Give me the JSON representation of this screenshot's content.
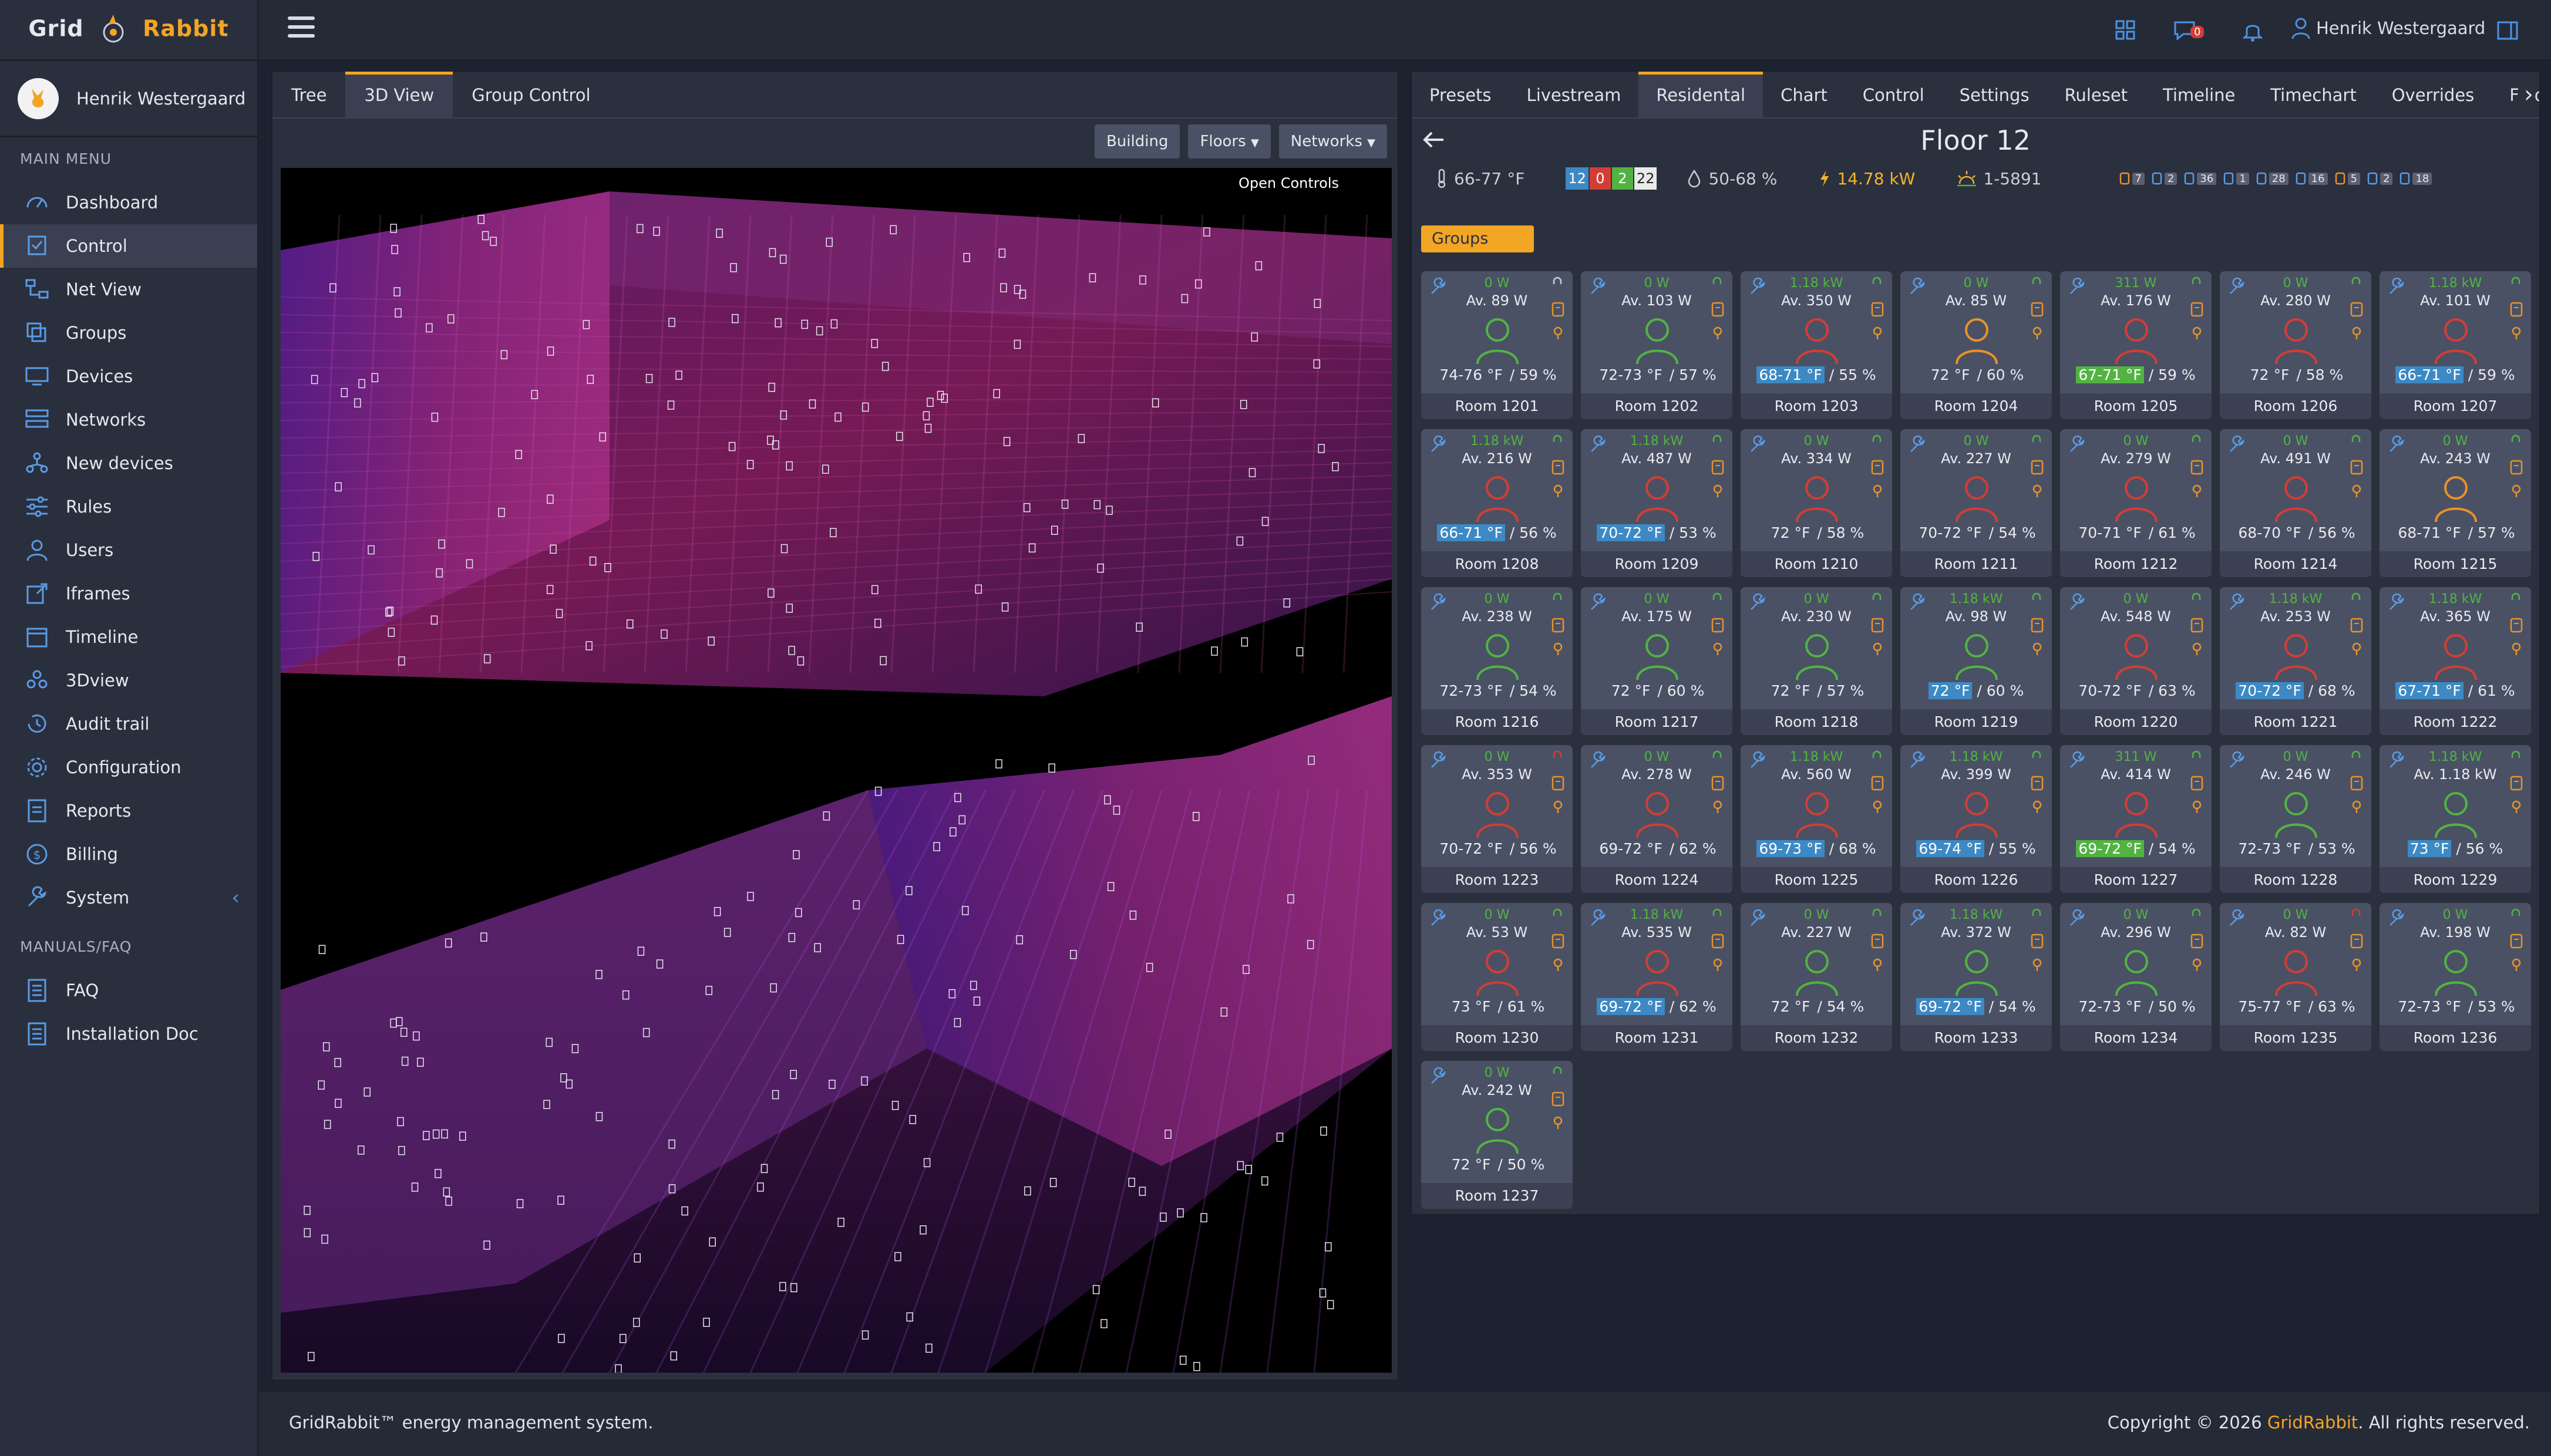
{
  "brand": {
    "part1": "Grid",
    "part2": "Rabbit"
  },
  "user": {
    "name": "Henrik Westergaard"
  },
  "sidebar": {
    "main_header": "MAIN MENU",
    "items": [
      {
        "label": "Dashboard",
        "icon": "dashboard-icon"
      },
      {
        "label": "Control",
        "icon": "control-icon",
        "active": true
      },
      {
        "label": "Net View",
        "icon": "net-view-icon"
      },
      {
        "label": "Groups",
        "icon": "groups-icon"
      },
      {
        "label": "Devices",
        "icon": "devices-icon"
      },
      {
        "label": "Networks",
        "icon": "networks-icon"
      },
      {
        "label": "New devices",
        "icon": "new-devices-icon"
      },
      {
        "label": "Rules",
        "icon": "rules-icon"
      },
      {
        "label": "Users",
        "icon": "users-icon"
      },
      {
        "label": "Iframes",
        "icon": "iframes-icon"
      },
      {
        "label": "Timeline",
        "icon": "timeline-icon"
      },
      {
        "label": "3Dview",
        "icon": "3dview-icon"
      },
      {
        "label": "Audit trail",
        "icon": "audit-trail-icon"
      },
      {
        "label": "Configuration",
        "icon": "configuration-icon"
      },
      {
        "label": "Reports",
        "icon": "reports-icon"
      },
      {
        "label": "Billing",
        "icon": "billing-icon"
      },
      {
        "label": "System",
        "icon": "system-icon"
      }
    ],
    "manuals_header": "MANUALS/FAQ",
    "manuals": [
      {
        "label": "FAQ",
        "icon": "faq-icon"
      },
      {
        "label": "Installation Doc",
        "icon": "installation-doc-icon"
      }
    ]
  },
  "topbar": {
    "message_count": "0"
  },
  "left_panel": {
    "tabs": [
      "Tree",
      "3D View",
      "Group Control"
    ],
    "active_tab": 1,
    "buttons": {
      "building": "Building",
      "floors": "Floors",
      "networks": "Networks"
    },
    "open_controls": "Open Controls"
  },
  "right_panel": {
    "tabs": [
      "Presets",
      "Livestream",
      "Residental",
      "Chart",
      "Control",
      "Settings",
      "Ruleset",
      "Timeline",
      "Timechart",
      "Overrides",
      "Floorp"
    ],
    "active_tab": 2,
    "floor_title": "Floor 12",
    "stats": {
      "temp": "66-77 °F",
      "counts": {
        "blue": "12",
        "red": "0",
        "green": "2",
        "white": "22"
      },
      "humidity": "50-68 %",
      "power": "14.78 kW",
      "light": "1-5891"
    },
    "device_badges": [
      "7",
      "2",
      "36",
      "1",
      "28",
      "16",
      "5",
      "2",
      "18"
    ],
    "groups_label": "Groups",
    "rooms": [
      {
        "name": "Room 1201",
        "cur": "0 W",
        "avg": "Av. 89 W",
        "temp": "74-76 °F",
        "hum": "59 %",
        "tc": "",
        "pc": "green",
        "cc": "white"
      },
      {
        "name": "Room 1202",
        "cur": "0 W",
        "avg": "Av. 103 W",
        "temp": "72-73 °F",
        "hum": "57 %",
        "tc": "",
        "pc": "green",
        "cc": "green"
      },
      {
        "name": "Room 1203",
        "cur": "1.18 kW",
        "avg": "Av. 350 W",
        "temp": "68-71 °F",
        "hum": "55 %",
        "tc": "blue",
        "pc": "red",
        "cc": "green"
      },
      {
        "name": "Room 1204",
        "cur": "0 W",
        "avg": "Av. 85 W",
        "temp": "72 °F",
        "hum": "60 %",
        "tc": "",
        "pc": "orange",
        "cc": "green"
      },
      {
        "name": "Room 1205",
        "cur": "311 W",
        "avg": "Av. 176 W",
        "temp": "67-71 °F",
        "hum": "59 %",
        "tc": "green",
        "pc": "red",
        "cc": "green"
      },
      {
        "name": "Room 1206",
        "cur": "0 W",
        "avg": "Av. 280 W",
        "temp": "72 °F",
        "hum": "58 %",
        "tc": "",
        "pc": "red",
        "cc": "green"
      },
      {
        "name": "Room 1207",
        "cur": "1.18 kW",
        "avg": "Av. 101 W",
        "temp": "66-71 °F",
        "hum": "59 %",
        "tc": "blue",
        "pc": "red",
        "cc": "green"
      },
      {
        "name": "Room 1208",
        "cur": "1.18 kW",
        "avg": "Av. 216 W",
        "temp": "66-71 °F",
        "hum": "56 %",
        "tc": "blue",
        "pc": "red",
        "cc": "green"
      },
      {
        "name": "Room 1209",
        "cur": "1.18 kW",
        "avg": "Av. 487 W",
        "temp": "70-72 °F",
        "hum": "53 %",
        "tc": "blue",
        "pc": "red",
        "cc": "green"
      },
      {
        "name": "Room 1210",
        "cur": "0 W",
        "avg": "Av. 334 W",
        "temp": "72 °F",
        "hum": "58 %",
        "tc": "",
        "pc": "red",
        "cc": "green"
      },
      {
        "name": "Room 1211",
        "cur": "0 W",
        "avg": "Av. 227 W",
        "temp": "70-72 °F",
        "hum": "54 %",
        "tc": "",
        "pc": "red",
        "cc": "green"
      },
      {
        "name": "Room 1212",
        "cur": "0 W",
        "avg": "Av. 279 W",
        "temp": "70-71 °F",
        "hum": "61 %",
        "tc": "",
        "pc": "red",
        "cc": "green"
      },
      {
        "name": "Room 1214",
        "cur": "0 W",
        "avg": "Av. 491 W",
        "temp": "68-70 °F",
        "hum": "56 %",
        "tc": "",
        "pc": "red",
        "cc": "green"
      },
      {
        "name": "Room 1215",
        "cur": "0 W",
        "avg": "Av. 243 W",
        "temp": "68-71 °F",
        "hum": "57 %",
        "tc": "",
        "pc": "orange",
        "cc": "green"
      },
      {
        "name": "Room 1216",
        "cur": "0 W",
        "avg": "Av. 238 W",
        "temp": "72-73 °F",
        "hum": "54 %",
        "tc": "",
        "pc": "green",
        "cc": "green"
      },
      {
        "name": "Room 1217",
        "cur": "0 W",
        "avg": "Av. 175 W",
        "temp": "72 °F",
        "hum": "60 %",
        "tc": "",
        "pc": "green",
        "cc": "green"
      },
      {
        "name": "Room 1218",
        "cur": "0 W",
        "avg": "Av. 230 W",
        "temp": "72 °F",
        "hum": "57 %",
        "tc": "",
        "pc": "green",
        "cc": "green"
      },
      {
        "name": "Room 1219",
        "cur": "1.18 kW",
        "avg": "Av. 98 W",
        "temp": "72 °F",
        "hum": "60 %",
        "tc": "blue",
        "pc": "green",
        "cc": "green"
      },
      {
        "name": "Room 1220",
        "cur": "0 W",
        "avg": "Av. 548 W",
        "temp": "70-72 °F",
        "hum": "63 %",
        "tc": "",
        "pc": "red",
        "cc": "green"
      },
      {
        "name": "Room 1221",
        "cur": "1.18 kW",
        "avg": "Av. 253 W",
        "temp": "70-72 °F",
        "hum": "68 %",
        "tc": "blue",
        "pc": "red",
        "cc": "green"
      },
      {
        "name": "Room 1222",
        "cur": "1.18 kW",
        "avg": "Av. 365 W",
        "temp": "67-71 °F",
        "hum": "61 %",
        "tc": "blue",
        "pc": "red",
        "cc": "green"
      },
      {
        "name": "Room 1223",
        "cur": "0 W",
        "avg": "Av. 353 W",
        "temp": "70-72 °F",
        "hum": "56 %",
        "tc": "",
        "pc": "red",
        "cc": "red"
      },
      {
        "name": "Room 1224",
        "cur": "0 W",
        "avg": "Av. 278 W",
        "temp": "69-72 °F",
        "hum": "62 %",
        "tc": "",
        "pc": "red",
        "cc": "green"
      },
      {
        "name": "Room 1225",
        "cur": "1.18 kW",
        "avg": "Av. 560 W",
        "temp": "69-73 °F",
        "hum": "68 %",
        "tc": "blue",
        "pc": "red",
        "cc": "green"
      },
      {
        "name": "Room 1226",
        "cur": "1.18 kW",
        "avg": "Av. 399 W",
        "temp": "69-74 °F",
        "hum": "55 %",
        "tc": "blue",
        "pc": "red",
        "cc": "green"
      },
      {
        "name": "Room 1227",
        "cur": "311 W",
        "avg": "Av. 414 W",
        "temp": "69-72 °F",
        "hum": "54 %",
        "tc": "green",
        "pc": "red",
        "cc": "green"
      },
      {
        "name": "Room 1228",
        "cur": "0 W",
        "avg": "Av. 246 W",
        "temp": "72-73 °F",
        "hum": "53 %",
        "tc": "",
        "pc": "green",
        "cc": "green"
      },
      {
        "name": "Room 1229",
        "cur": "1.18 kW",
        "avg": "Av. 1.18 kW",
        "temp": "73 °F",
        "hum": "56 %",
        "tc": "blue",
        "pc": "green",
        "cc": "green"
      },
      {
        "name": "Room 1230",
        "cur": "0 W",
        "avg": "Av. 53 W",
        "temp": "73 °F",
        "hum": "61 %",
        "tc": "",
        "pc": "red",
        "cc": "green"
      },
      {
        "name": "Room 1231",
        "cur": "1.18 kW",
        "avg": "Av. 535 W",
        "temp": "69-72 °F",
        "hum": "62 %",
        "tc": "blue",
        "pc": "red",
        "cc": "green"
      },
      {
        "name": "Room 1232",
        "cur": "0 W",
        "avg": "Av. 227 W",
        "temp": "72 °F",
        "hum": "54 %",
        "tc": "",
        "pc": "green",
        "cc": "green"
      },
      {
        "name": "Room 1233",
        "cur": "1.18 kW",
        "avg": "Av. 372 W",
        "temp": "69-72 °F",
        "hum": "54 %",
        "tc": "blue",
        "pc": "green",
        "cc": "green"
      },
      {
        "name": "Room 1234",
        "cur": "0 W",
        "avg": "Av. 296 W",
        "temp": "72-73 °F",
        "hum": "50 %",
        "tc": "",
        "pc": "green",
        "cc": "green"
      },
      {
        "name": "Room 1235",
        "cur": "0 W",
        "avg": "Av. 82 W",
        "temp": "75-77 °F",
        "hum": "63 %",
        "tc": "",
        "pc": "red",
        "cc": "red"
      },
      {
        "name": "Room 1236",
        "cur": "0 W",
        "avg": "Av. 198 W",
        "temp": "72-73 °F",
        "hum": "53 %",
        "tc": "",
        "pc": "green",
        "cc": "green"
      },
      {
        "name": "Room 1237",
        "cur": "0 W",
        "avg": "Av. 242 W",
        "temp": "72 °F",
        "hum": "50 %",
        "tc": "",
        "pc": "green",
        "cc": "green"
      }
    ]
  },
  "footer": {
    "left": "GridRabbit™ energy management system.",
    "copyright_prefix": "Copyright © 2026 ",
    "copyright_brand": "GridRabbit",
    "copyright_suffix": ". All rights reserved."
  },
  "colors": {
    "accent": "#f3a524",
    "green": "#52b343",
    "red": "#d33d35",
    "blue": "#3d89c4",
    "orange": "#e8922a"
  }
}
